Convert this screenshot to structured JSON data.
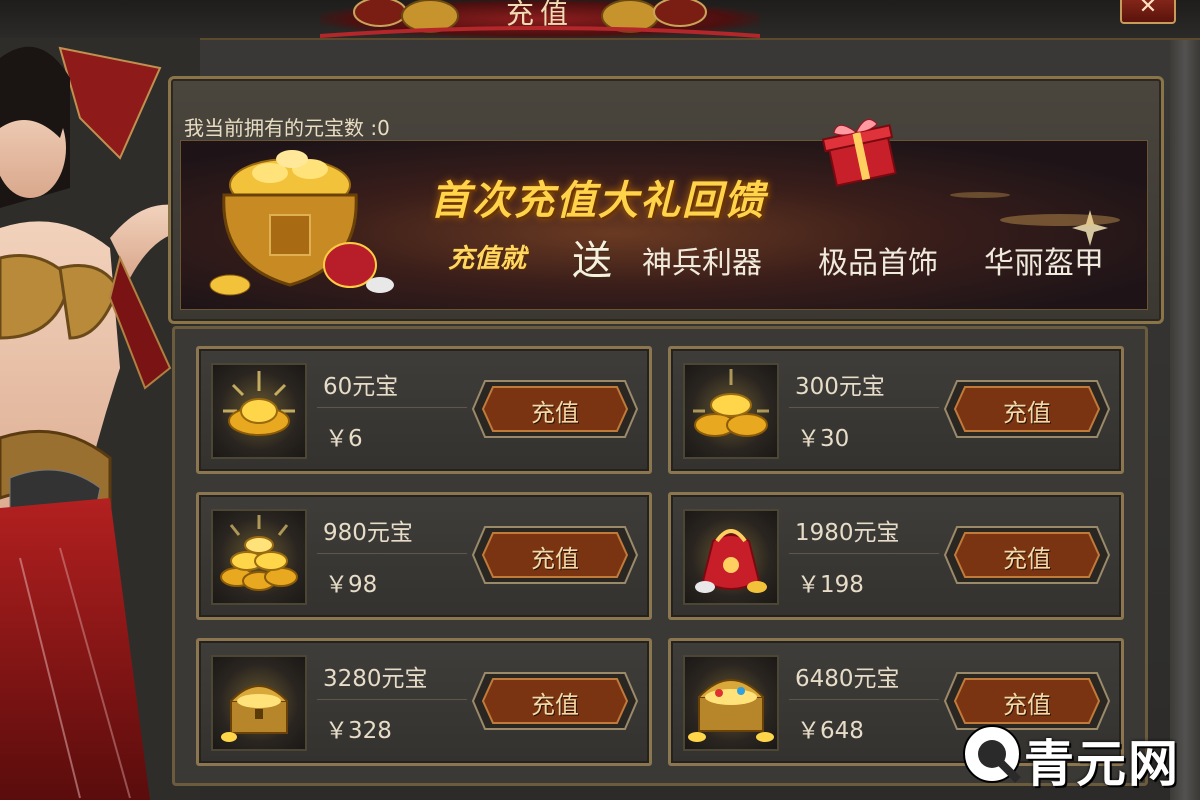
{
  "window": {
    "title": "充值",
    "close_symbol": "✕"
  },
  "balance": {
    "label": "我当前拥有的元宝数 :0"
  },
  "banner": {
    "headline": "首次充值大礼回馈",
    "sub_prefix": "充值就",
    "send": "送",
    "items": [
      "神兵利器",
      "极品首饰",
      "华丽盔甲"
    ]
  },
  "packages": [
    {
      "name": "60元宝",
      "price": "￥6",
      "button": "充值",
      "icon": "single-gold-ingot-icon"
    },
    {
      "name": "300元宝",
      "price": "￥30",
      "button": "充值",
      "icon": "gold-ingot-stack-icon"
    },
    {
      "name": "980元宝",
      "price": "￥98",
      "button": "充值",
      "icon": "gold-ingot-pile-icon"
    },
    {
      "name": "1980元宝",
      "price": "￥198",
      "button": "充值",
      "icon": "treasure-bag-icon"
    },
    {
      "name": "3280元宝",
      "price": "￥328",
      "button": "充值",
      "icon": "treasure-chest-icon"
    },
    {
      "name": "6480元宝",
      "price": "￥648",
      "button": "充值",
      "icon": "large-treasure-chest-icon"
    }
  ],
  "watermark": {
    "text": "青元网"
  },
  "colors": {
    "gold": "#ffd34a",
    "frame": "#8b7650",
    "panel": "#3b3935",
    "button": "#7a3412"
  }
}
